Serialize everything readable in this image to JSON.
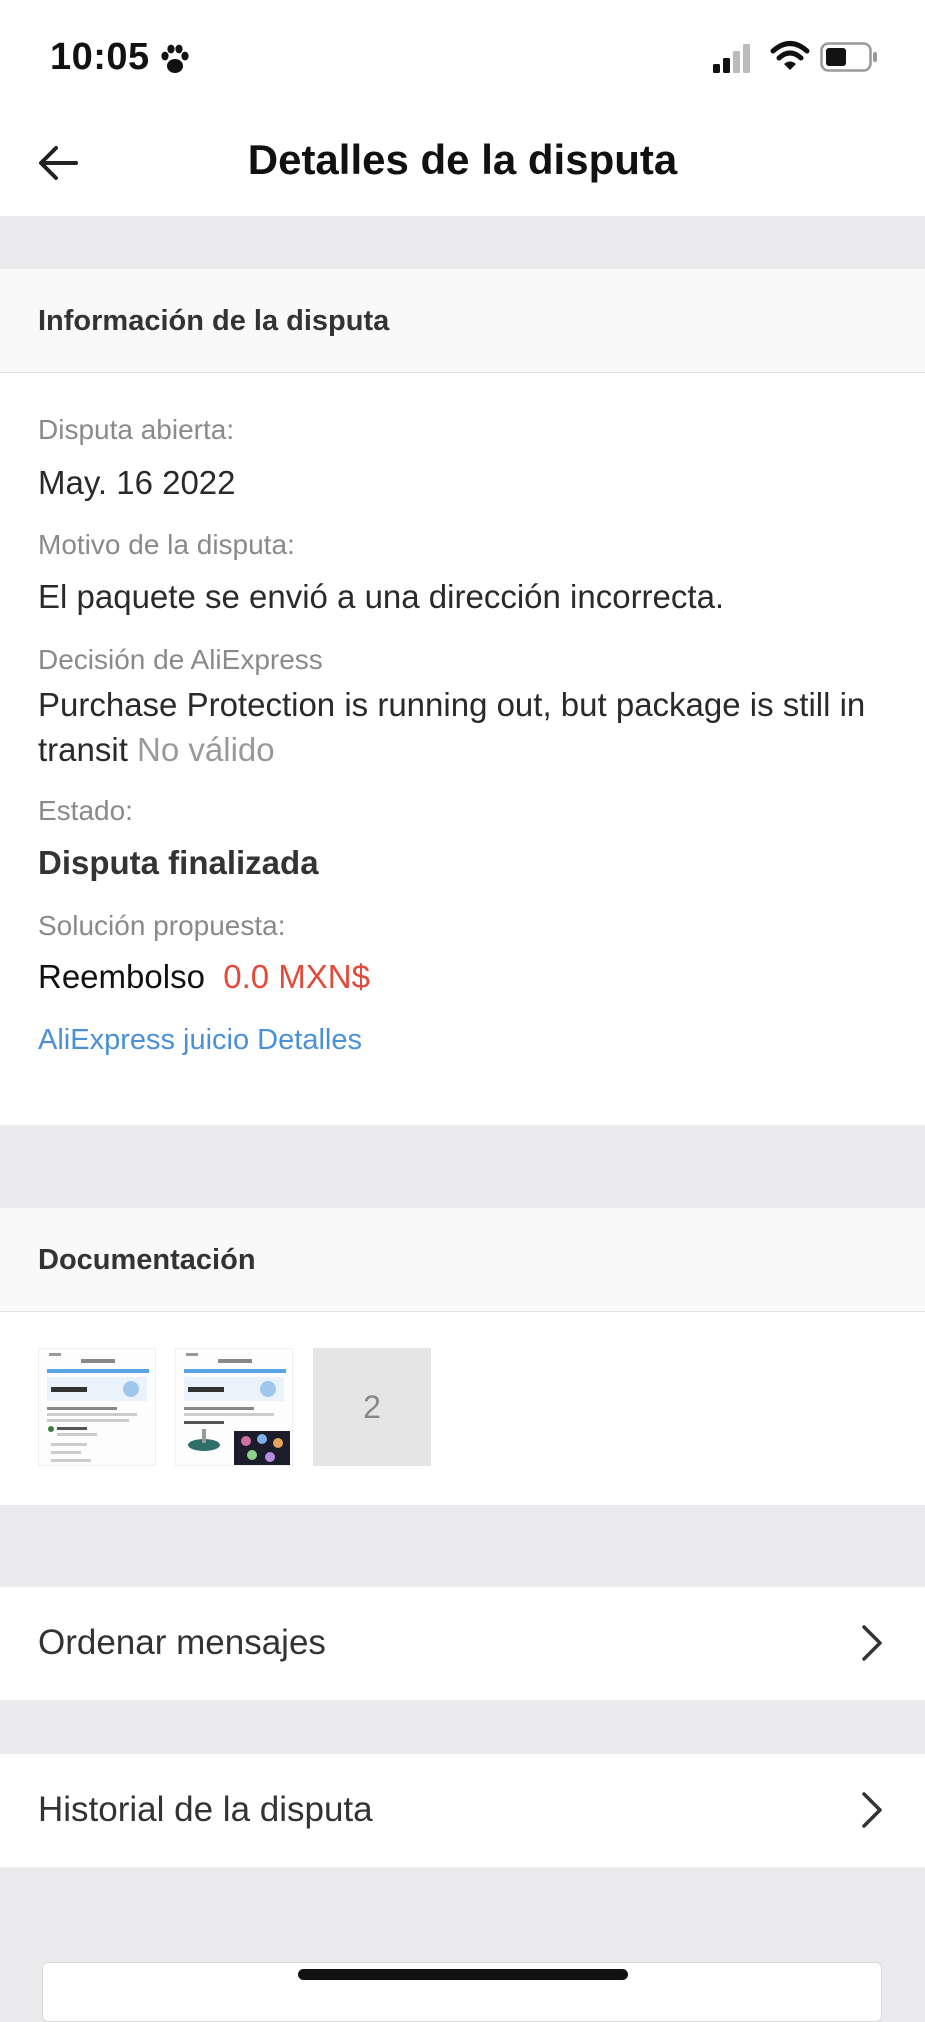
{
  "status_bar": {
    "time": "10:05",
    "icons": [
      "paw-icon",
      "cellular-signal-icon",
      "wifi-icon",
      "battery-icon"
    ]
  },
  "nav": {
    "title": "Detalles de la disputa",
    "back_icon": "arrow-left-icon"
  },
  "dispute_info": {
    "heading": "Información de la disputa",
    "opened_label": "Disputa abierta:",
    "opened_value": "May. 16 2022",
    "reason_label": "Motivo de la disputa:",
    "reason_value": "El paquete se envió a una dirección incorrecta.",
    "decision_label": "Decisión de AliExpress",
    "decision_value": "Purchase Protection is running out, but package is still in transit",
    "decision_status": "No válido",
    "state_label": "Estado:",
    "state_value": "Disputa finalizada",
    "solution_label": "Solución propuesta:",
    "solution_type": "Reembolso",
    "solution_amount": "0.0 MXN$",
    "judgment_link": "AliExpress juicio Detalles"
  },
  "documentation": {
    "heading": "Documentación",
    "thumbnails": [
      "screenshot-thumbnail",
      "screenshot-thumbnail"
    ],
    "more_count": "2"
  },
  "rows": {
    "order_messages": "Ordenar mensajes",
    "dispute_history": "Historial de la disputa"
  },
  "colors": {
    "accent_link": "#4a90d9",
    "amount_red": "#e24b3b",
    "page_bg": "#ebebed"
  }
}
